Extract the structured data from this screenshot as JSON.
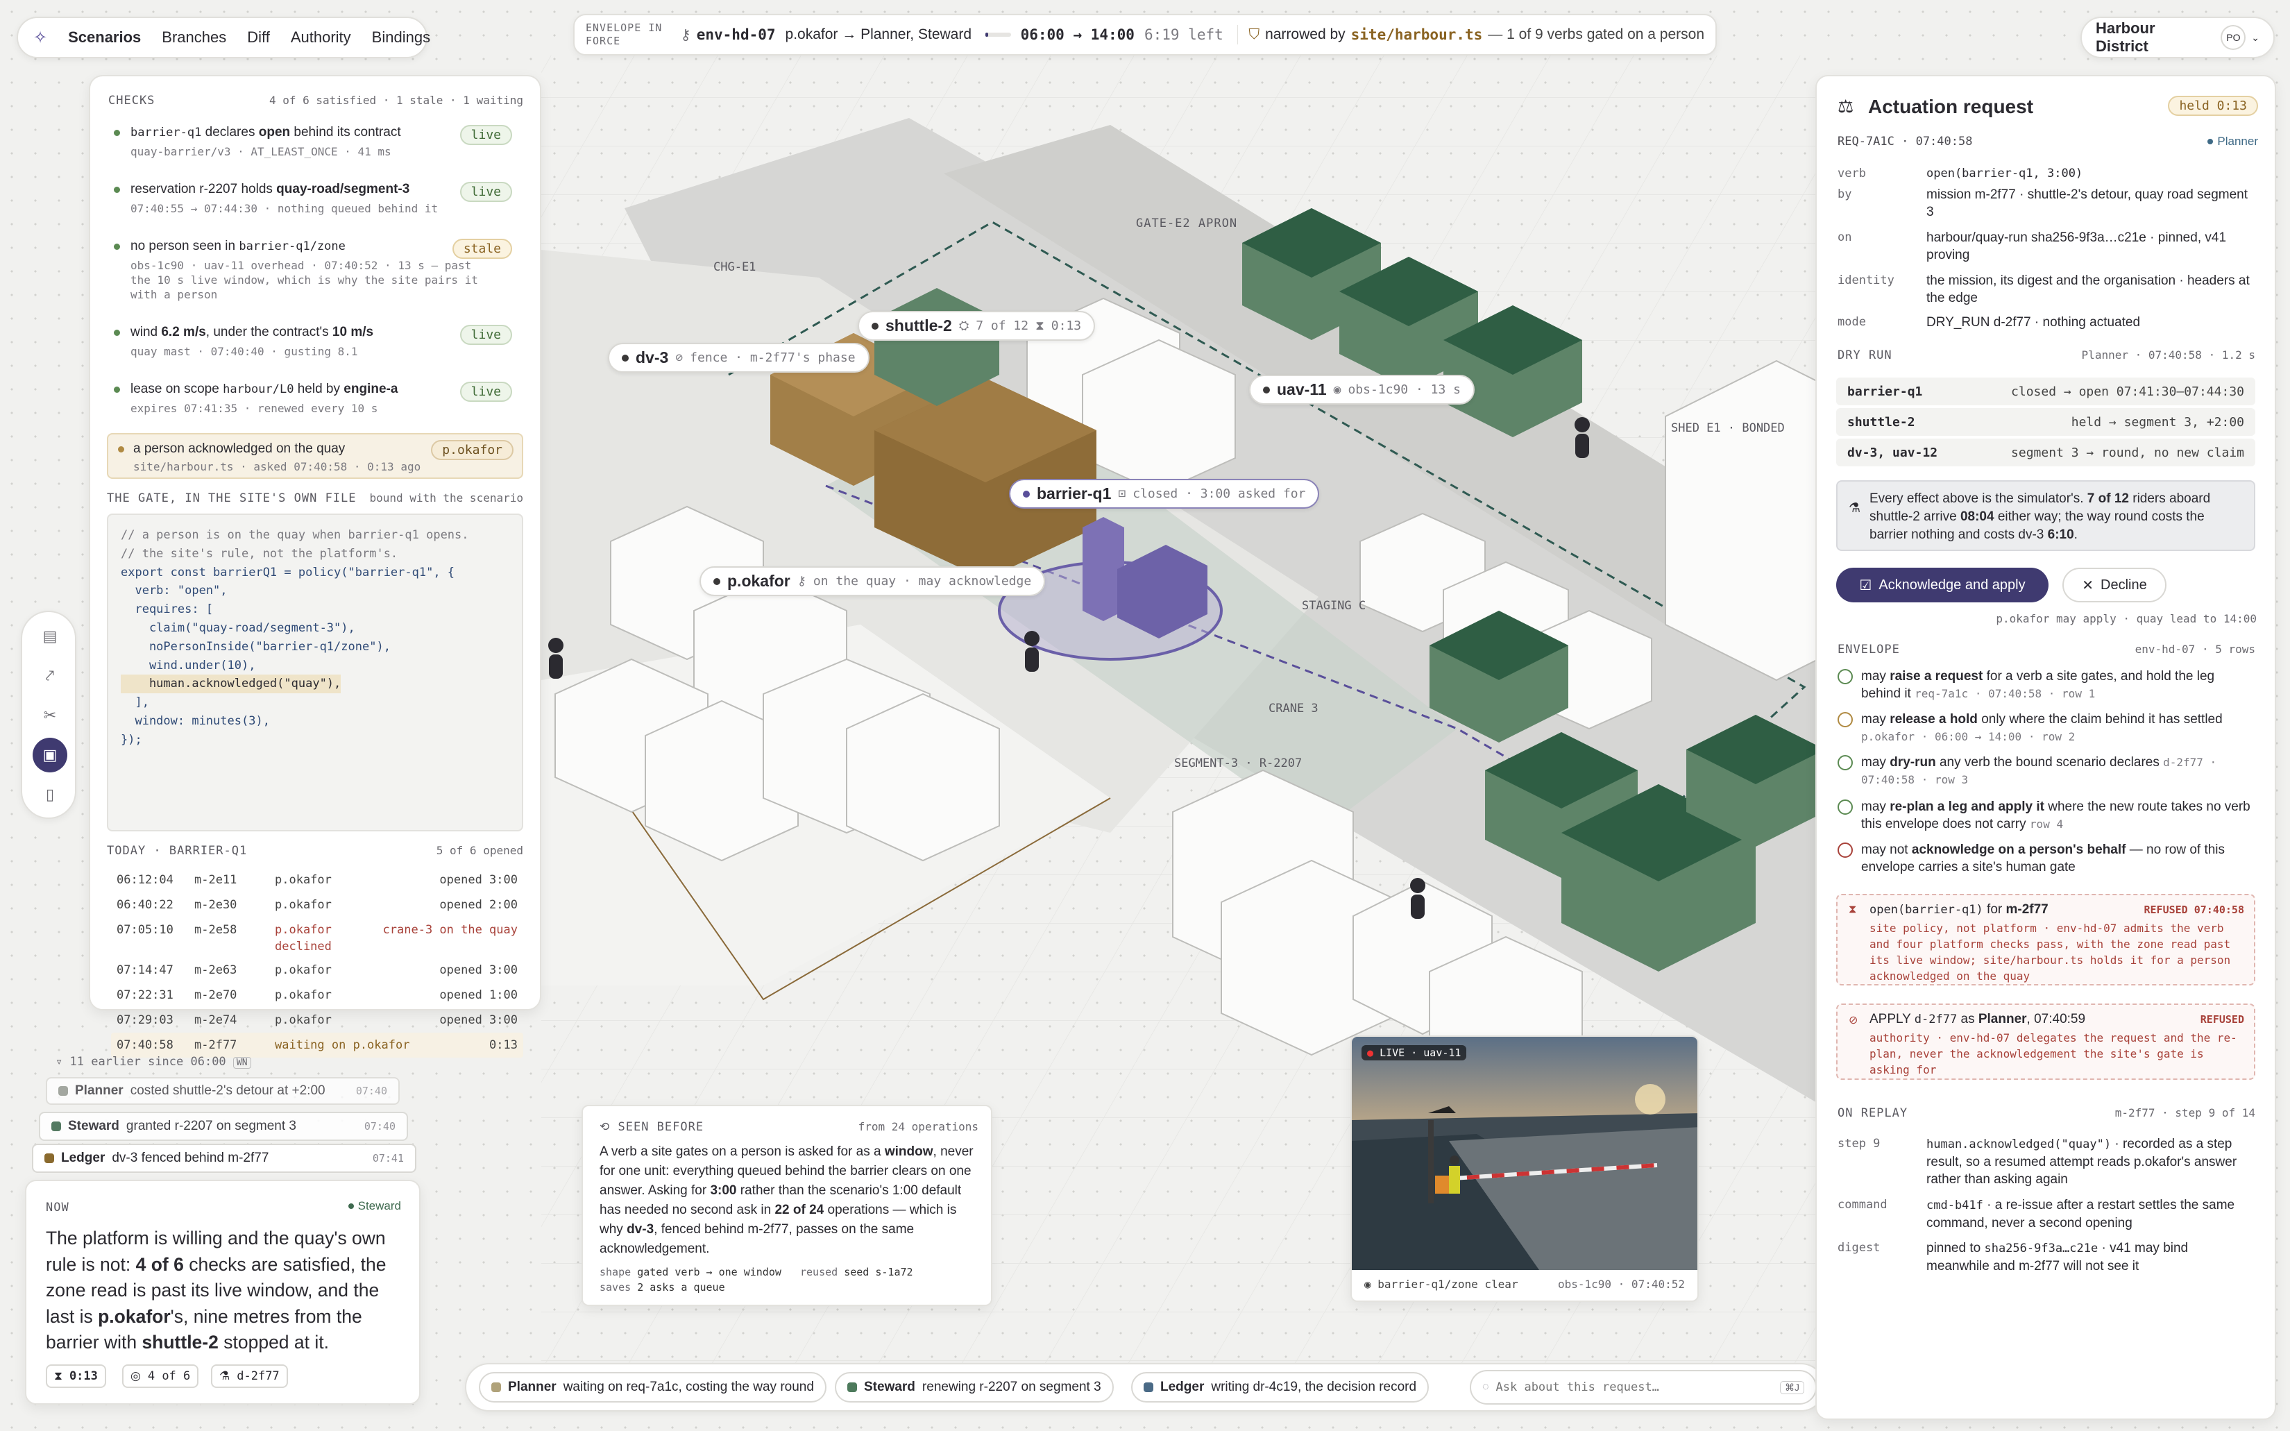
{
  "topnav": {
    "tabs": [
      "Scenarios",
      "Branches",
      "Diff",
      "Authority",
      "Bindings"
    ]
  },
  "envelope": {
    "label_1": "ENVELOPE IN",
    "label_2": "FORCE",
    "id": "env-hd-07",
    "who": "p.okafor → Planner, Steward",
    "progress": 0.1,
    "window": "06:00 → 14:00",
    "left": "6:19 left",
    "narrowed_prefix": "narrowed by",
    "narrowed_file": "site/harbour.ts",
    "narrowed_rest": "— 1 of 9 verbs gated on a person"
  },
  "org": {
    "name": "Harbour District",
    "initials": "PO"
  },
  "checks": {
    "title": "CHECKS",
    "summary": "4 of 6 satisfied · 1 stale · 1 waiting",
    "items": [
      {
        "pre": "barrier-q1",
        "mid": " declares ",
        "bold": "open",
        "post": " behind its contract",
        "sub": "quay-barrier/v3 · AT_LEAST_ONCE · 41 ms",
        "badge": "live"
      },
      {
        "pre": "reservation r-2207 holds ",
        "bold": "quay-road/segment-3",
        "sub": "07:40:55 → 07:44:30 · nothing queued behind it",
        "badge": "live"
      },
      {
        "pre": "no person seen in ",
        "code": "barrier-q1/zone",
        "sub": "obs-1c90 · uav-11 overhead · 07:40:52 · 13 s — past the 10 s live window, which is why the site pairs it with a person",
        "badge": "stale"
      },
      {
        "pre": "wind ",
        "bold": "6.2 m/s",
        "mid": ", under the contract's ",
        "bold2": "10 m/s",
        "sub": "quay mast · 07:40:40 · gusting 8.1",
        "badge": "live"
      },
      {
        "pre": "lease on scope ",
        "code": "harbour/L0",
        "mid": " held by ",
        "bold": "engine-a",
        "sub": "expires 07:41:35 · renewed every 10 s",
        "badge": "live"
      }
    ],
    "waiting": {
      "text": "a person acknowledged on the quay",
      "sub": "site/harbour.ts · asked 07:40:58 · 0:13 ago",
      "badge": "p.okafor"
    }
  },
  "gate": {
    "title": "THE GATE, IN THE SITE'S OWN FILE",
    "bound": "bound with the scenario",
    "code": [
      "// a person is on the quay when barrier-q1 opens.",
      "// the site's rule, not the platform's.",
      "export const barrierQ1 = policy(\"barrier-q1\", {",
      "  verb: \"open\",",
      "  requires: [",
      "    claim(\"quay-road/segment-3\"),",
      "    noPersonInside(\"barrier-q1/zone\"),",
      "    wind.under(10),",
      "    human.acknowledged(\"quay\"),",
      "  ],",
      "  window: minutes(3),",
      "});"
    ]
  },
  "today": {
    "title": "TODAY · BARRIER-Q1",
    "summary": "5 of 6 opened",
    "rows": [
      [
        "06:12:04",
        "m-2e11",
        "p.okafor",
        "opened 3:00"
      ],
      [
        "06:40:22",
        "m-2e30",
        "p.okafor",
        "opened 2:00"
      ],
      [
        "07:05:10",
        "m-2e58",
        "p.okafor",
        "crane-3 on the quay"
      ],
      [
        "07:14:47",
        "m-2e63",
        "p.okafor",
        "opened 3:00"
      ],
      [
        "07:22:31",
        "m-2e70",
        "p.okafor",
        "opened 1:00"
      ],
      [
        "07:29:03",
        "m-2e74",
        "p.okafor",
        "opened 3:00"
      ],
      [
        "07:40:58",
        "m-2f77",
        "waiting on p.okafor",
        "0:13"
      ]
    ],
    "declined": "declined"
  },
  "history": {
    "toggle": "11 earlier since 06:00",
    "key": "WN",
    "items": [
      {
        "who": "Planner",
        "text": "costed shuttle-2's detour at +2:00",
        "time": "07:40",
        "color": "#8a8f86"
      },
      {
        "who": "Steward",
        "text": "granted r-2207 on segment 3",
        "time": "07:40",
        "color": "#3f6a4f"
      },
      {
        "who": "Ledger",
        "text": "dv-3 fenced behind m-2f77",
        "time": "07:41",
        "color": "#8a6a2e"
      }
    ]
  },
  "now": {
    "title": "NOW",
    "agent": "Steward",
    "text_a": "The platform is willing and the quay's own rule is not: ",
    "b1": "4 of 6",
    "text_b": " checks are satisfied, the zone read is past its live window, and the last is ",
    "b2": "p.okafor",
    "text_c": "'s, nine metres from the barrier with ",
    "b3": "shuttle-2",
    "text_d": " stopped at it.",
    "chips": [
      "0:13",
      "4 of 6",
      "d-2f77"
    ]
  },
  "seen": {
    "title": "SEEN BEFORE",
    "from": "from 24 operations",
    "t1": "A verb a site gates on a person is asked for as a ",
    "b1": "window",
    "t2": ", never for one unit: everything queued behind the barrier clears on one answer. Asking for ",
    "b2": "3:00",
    "t3": " rather than the scenario's 1:00 default has needed no second ask in ",
    "b3": "22 of 24",
    "t4": " operations — which is why ",
    "b4": "dv-3",
    "t5": ", fenced behind m-2f77, passes on the same acknowledgement.",
    "shape_k": "shape",
    "shape_v": "gated verb → one window",
    "reused_k": "reused",
    "reused_v": "seed s-1a72",
    "saves_k": "saves",
    "saves_v": "2 asks a queue"
  },
  "camera": {
    "live": "LIVE",
    "feed": "uav-11",
    "caption": "barrier-q1/zone clear",
    "obs": "obs-1c90 · 07:40:52"
  },
  "map": {
    "labels": {
      "gate": "GATE-E2 APRON",
      "chg": "CHG-E1",
      "shed": "SHED E1 · BONDED",
      "staging": "STAGING C",
      "crane": "CRANE 3",
      "segment": "SEGMENT-3 · R-2207"
    },
    "tags": [
      {
        "name": "shuttle-2",
        "meta": "7 of 12",
        "extra": "0:13"
      },
      {
        "name": "dv-3",
        "meta": "fence · m-2f77's phase"
      },
      {
        "name": "uav-11",
        "meta": "obs-1c90 · 13 s"
      },
      {
        "name": "barrier-q1",
        "meta": "closed · 3:00 asked for"
      },
      {
        "name": "p.okafor",
        "meta": "on the quay · may acknowledge"
      }
    ]
  },
  "bottom": {
    "agents": [
      {
        "who": "Planner",
        "text": "waiting on req-7a1c, costing the way round",
        "color": "#b0a27a"
      },
      {
        "who": "Steward",
        "text": "renewing r-2207 on segment 3",
        "color": "#4d7a5c"
      },
      {
        "who": "Ledger",
        "text": "writing dr-4c19, the decision record",
        "color": "#4a6a86"
      }
    ],
    "ask_placeholder": "Ask about this request…",
    "ask_key": "⌘J"
  },
  "request": {
    "title": "Actuation request",
    "held": "held 0:13",
    "id": "REQ-7A1C · 07:40:58",
    "agent": "Planner",
    "fields": [
      {
        "k": "verb",
        "v": "open(barrier-q1, 3:00)"
      },
      {
        "k": "by",
        "v": "mission m-2f77 · shuttle-2's detour, quay road segment 3"
      },
      {
        "k": "on",
        "v": "harbour/quay-run sha256-9f3a…c21e · pinned, v41 proving"
      },
      {
        "k": "identity",
        "v": "the mission, its digest and the organisation · headers at the edge"
      },
      {
        "k": "mode",
        "v": "DRY_RUN d-2f77 · nothing actuated"
      }
    ],
    "dry_title": "DRY RUN",
    "dry_meta": "Planner · 07:40:58 · 1.2 s",
    "dry": [
      {
        "a": "barrier-q1",
        "b": "closed → open 07:41:30–07:44:30"
      },
      {
        "a": "shuttle-2",
        "b": "held → segment 3, +2:00"
      },
      {
        "a": "dv-3, uav-12",
        "b": "segment 3 → round, no new claim"
      }
    ],
    "note_a": "Every effect above is the simulator's. ",
    "note_b1": "7 of 12",
    "note_c": " riders aboard shuttle-2 arrive ",
    "note_b2": "08:04",
    "note_d": " either way; the way round costs the barrier nothing and costs dv-3 ",
    "note_b3": "6:10",
    "note_e": ".",
    "ack": "Acknowledge and apply",
    "decline": "Decline",
    "may": "p.okafor may apply · quay lead to 14:00",
    "env_title": "ENVELOPE",
    "env_meta": "env-hd-07 · 5 rows",
    "env": [
      {
        "pre": "may ",
        "b": "raise a request",
        "post": " for a verb a site gates, and hold the leg behind it",
        "sm": "req-7a1c · 07:40:58 · row 1",
        "st": "ok"
      },
      {
        "pre": "may ",
        "b": "release a hold",
        "post": " only where the claim behind it has settled",
        "sm": "p.okafor · 06:00 → 14:00 · row 2",
        "st": "warn"
      },
      {
        "pre": "may ",
        "b": "dry-run",
        "post": " any verb the bound scenario declares",
        "sm": "d-2f77 · 07:40:58 · row 3",
        "st": "ok"
      },
      {
        "pre": "may ",
        "b": "re-plan a leg and apply it",
        "post": " where the new route takes no verb this envelope does not carry",
        "sm": "row 4",
        "st": "ok"
      },
      {
        "pre": "may not ",
        "b": "acknowledge on a person's behalf",
        "post": " — no row of this envelope carries a site's human gate",
        "sm": "",
        "st": "no"
      }
    ],
    "ref1": {
      "code": "open(barrier-q1)",
      "for": " for ",
      "who": "m-2f77",
      "tag": "REFUSED 07:40:58",
      "body": "site policy, not platform · env-hd-07 admits the verb and four platform checks pass, with the zone read past its live window; site/harbour.ts holds it for a person acknowledged on the quay"
    },
    "ref2": {
      "pre": "APPLY ",
      "code": "d-2f77",
      "as": " as ",
      "who": "Planner",
      "time": ", 07:40:59",
      "tag": "REFUSED",
      "body": "authority · env-hd-07 delegates the request and the re-plan, never the acknowledgement the site's gate is asking for"
    },
    "replay_title": "ON REPLAY",
    "replay_meta": "m-2f77 · step 9 of 14",
    "replay": [
      {
        "k": "step 9",
        "code": "human.acknowledged(\"quay\")",
        "v": " · recorded as a step result, so a resumed attempt reads p.okafor's answer rather than asking again"
      },
      {
        "k": "command",
        "code": "cmd-b41f",
        "v": " · a re-issue after a restart settles the same command, never a second opening"
      },
      {
        "k": "digest",
        "pre": "pinned to ",
        "code": "sha256-9f3a…c21e",
        "v": " · v41 may bind meanwhile and m-2f77 will not see it"
      }
    ]
  }
}
